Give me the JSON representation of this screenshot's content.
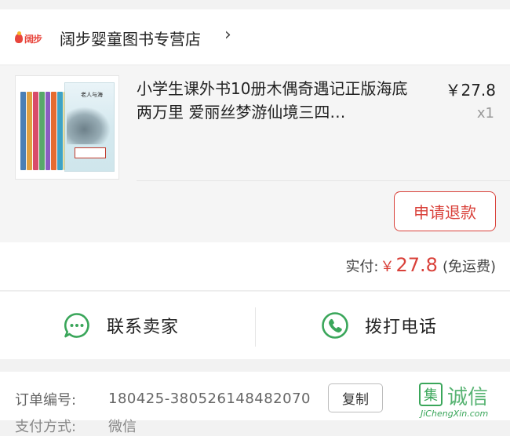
{
  "shop": {
    "logo_text": "阔步",
    "name": "阔步婴童图书专营店",
    "chevron": "›"
  },
  "product": {
    "cover_title": "老人与海",
    "title": "小学生课外书10册木偶奇遇记正版海底两万里 爱丽丝梦游仙境三四…",
    "price": "￥27.8",
    "quantity": "x1",
    "refund_button": "申请退款"
  },
  "payment": {
    "label": "实付:",
    "currency": "￥",
    "amount": "27.8",
    "shipping_note": "(免运费)"
  },
  "actions": {
    "contact_seller": "联系卖家",
    "call_phone": "拨打电话"
  },
  "order": {
    "number_label": "订单编号:",
    "number": "180425-380526148482070",
    "copy_button": "复制",
    "next_label": "支付方式:",
    "next_value": "微信"
  },
  "watermark": {
    "box_char": "集",
    "cn_text": "诚信",
    "en_text": "JiChengXin.com"
  },
  "colors": {
    "accent_red": "#d9413a",
    "icon_green": "#3aa65a",
    "background": "#f2f2f2"
  },
  "icons": {
    "chat": "chat-bubble-icon",
    "phone": "phone-icon"
  }
}
